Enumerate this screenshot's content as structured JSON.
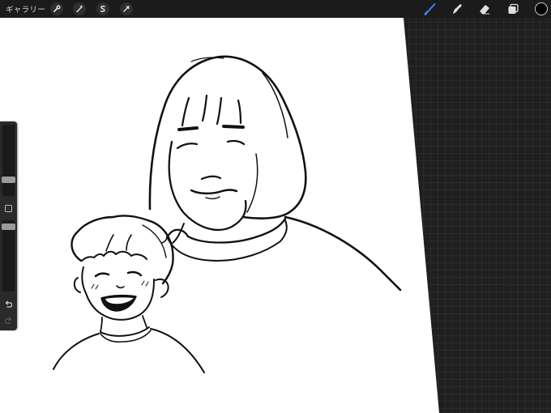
{
  "topbar": {
    "gallery_label": "ギャラリー",
    "left_tools": [
      {
        "name": "actions-wrench-icon"
      },
      {
        "name": "adjustments-wand-icon"
      },
      {
        "name": "selection-s-icon"
      },
      {
        "name": "transform-arrow-icon"
      }
    ],
    "right_tools": [
      {
        "name": "brush-icon",
        "active": true
      },
      {
        "name": "smudge-icon",
        "active": false
      },
      {
        "name": "eraser-icon",
        "active": false
      },
      {
        "name": "layers-icon",
        "active": false
      },
      {
        "name": "color-swatch",
        "color": "#000000"
      }
    ]
  },
  "sidebar": {
    "brush_size_slider": {
      "level": 0.2
    },
    "opacity_slider": {
      "level": 0.95
    }
  },
  "colors": {
    "active_tool": "#3d8bff",
    "workspace": "#1f1f1f",
    "toolbar": "#1b1b1b",
    "canvas": "#ffffff",
    "ink": "#111111"
  }
}
